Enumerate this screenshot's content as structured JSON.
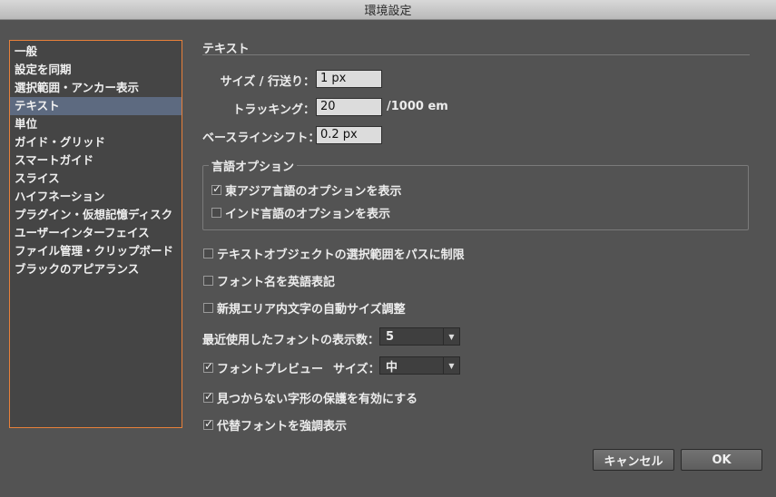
{
  "window": {
    "title": "環境設定"
  },
  "sidebar": {
    "items": [
      {
        "label": "一般"
      },
      {
        "label": "設定を同期"
      },
      {
        "label": "選択範囲・アンカー表示"
      },
      {
        "label": "テキスト"
      },
      {
        "label": "単位"
      },
      {
        "label": "ガイド・グリッド"
      },
      {
        "label": "スマートガイド"
      },
      {
        "label": "スライス"
      },
      {
        "label": "ハイフネーション"
      },
      {
        "label": "プラグイン・仮想記憶ディスク"
      },
      {
        "label": "ユーザーインターフェイス"
      },
      {
        "label": "ファイル管理・クリップボード"
      },
      {
        "label": "ブラックのアピアランス"
      }
    ],
    "selected_index": 3
  },
  "panel": {
    "section_title": "テキスト",
    "size_leading": {
      "label": "サイズ / 行送り：",
      "value": "1 px"
    },
    "tracking": {
      "label": "トラッキング：",
      "value": "20",
      "unit": "/1000 em"
    },
    "baseline_shift": {
      "label": "ベースラインシフト：",
      "value": "0.2 px"
    },
    "language_options": {
      "title": "言語オプション",
      "east_asian": {
        "label": "東アジア言語のオプションを表示",
        "checked": true
      },
      "indic": {
        "label": "インド言語のオプションを表示",
        "checked": false
      }
    },
    "type_object_selection": {
      "label": "テキストオブジェクトの選択範囲をパスに制限",
      "checked": false
    },
    "english_font_names": {
      "label": "フォント名を英語表記",
      "checked": false
    },
    "auto_size_area_type": {
      "label": "新規エリア内文字の自動サイズ調整",
      "checked": false
    },
    "recent_fonts": {
      "label": "最近使用したフォントの表示数：",
      "value": "5"
    },
    "font_preview": {
      "label": "フォントプレビュー",
      "checked": true,
      "size_label": "サイズ：",
      "size_value": "中"
    },
    "protect_missing_glyphs": {
      "label": "見つからない字形の保護を有効にする",
      "checked": true
    },
    "highlight_substituted_fonts": {
      "label": "代替フォントを強調表示",
      "checked": true
    }
  },
  "buttons": {
    "cancel": "キャンセル",
    "ok": "OK"
  }
}
